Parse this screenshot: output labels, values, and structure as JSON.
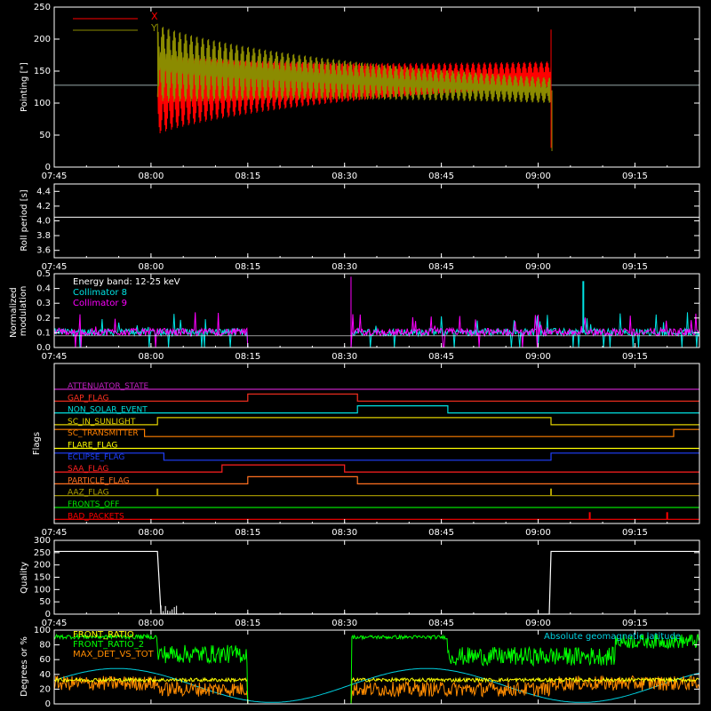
{
  "colors": {
    "axis": "#ffffff",
    "x": "#ff0000",
    "y": "#8b8b00",
    "coll8": "#00e5e5",
    "coll9": "#ff00ff",
    "front_ratio": "#ffff00",
    "front_ratio_2": "#00ff00",
    "max_det": "#ff8c00",
    "geomag": "#00d0e0"
  },
  "time_axis": {
    "start": "07:45",
    "end": "09:25",
    "ticks": [
      "07:45",
      "08:00",
      "08:15",
      "08:30",
      "08:45",
      "09:00",
      "09:15"
    ]
  },
  "chart_data": [
    {
      "type": "line",
      "id": "pointing",
      "ylabel": "Pointing [\"]",
      "ylim": [
        0,
        250
      ],
      "yticks": [
        "0",
        "50",
        "100",
        "150",
        "200",
        "250"
      ],
      "legend": "top-left",
      "series": [
        {
          "name": "X",
          "color_key": "x",
          "t_range": [
            "08:01",
            "09:02"
          ],
          "mean": [
            110,
            145
          ],
          "amp": [
            45,
            15
          ]
        },
        {
          "name": "Y",
          "color_key": "y",
          "t_range": [
            "08:01",
            "09:02"
          ],
          "mean": [
            165,
            120
          ],
          "amp": [
            45,
            15
          ]
        }
      ],
      "reference_level": 128
    },
    {
      "type": "line",
      "id": "roll",
      "ylabel": "Roll period [s]",
      "ylim": [
        3.5,
        4.5
      ],
      "yticks": [
        "3.6",
        "3.8",
        "4.0",
        "4.2",
        "4.4"
      ],
      "value": 4.05
    },
    {
      "type": "line",
      "id": "modulation",
      "ylabel": "Normalized modulation",
      "ylim": [
        0,
        0.5
      ],
      "yticks": [
        "0.0",
        "0.1",
        "0.2",
        "0.3",
        "0.4",
        "0.5"
      ],
      "annotation": "Energy band: 12-25 keV",
      "series": [
        {
          "name": "Collimator 8",
          "color_key": "coll8"
        },
        {
          "name": "Collimator 9",
          "color_key": "coll9"
        }
      ],
      "gap": [
        "08:15",
        "08:31"
      ]
    },
    {
      "type": "line",
      "id": "flags",
      "ylabel": "Flags",
      "series": [
        {
          "name": "ATTENUATOR_STATE",
          "color": "#c020c0",
          "on": []
        },
        {
          "name": "GAP_FLAG",
          "color": "#ff3020",
          "on": [
            [
              "08:15",
              "08:32"
            ]
          ]
        },
        {
          "name": "NON_SOLAR_EVENT",
          "color": "#00e0e0",
          "on": [
            [
              "08:32",
              "08:46"
            ]
          ]
        },
        {
          "name": "SC_IN_SUNLIGHT",
          "color": "#e0d000",
          "on": [
            [
              "08:01",
              "09:02"
            ]
          ]
        },
        {
          "name": "SC_TRANSMITTER",
          "color": "#ff8000",
          "off": [
            [
              "07:59",
              "09:21"
            ]
          ]
        },
        {
          "name": "FLARE_FLAG",
          "color": "#ffff00",
          "on": []
        },
        {
          "name": "ECLIPSE_FLAG",
          "color": "#2040ff",
          "off": [
            [
              "08:02",
              "09:02"
            ]
          ]
        },
        {
          "name": "SAA_FLAG",
          "color": "#ff2020",
          "on": [
            [
              "08:11",
              "08:30"
            ]
          ]
        },
        {
          "name": "PARTICLE_FLAG",
          "color": "#ff7020",
          "on": [
            [
              "08:15",
              "08:32"
            ]
          ]
        },
        {
          "name": "AAZ_FLAG",
          "color": "#b0a000",
          "spikes": [
            "08:01",
            "09:02"
          ]
        },
        {
          "name": "FRONTS_OFF",
          "color": "#00e000",
          "on": []
        },
        {
          "name": "BAD_PACKETS",
          "color": "#ff0000",
          "spikes": [
            "09:08",
            "09:20"
          ]
        }
      ]
    },
    {
      "type": "line",
      "id": "quality",
      "ylabel": "Quality",
      "ylim": [
        0,
        300
      ],
      "yticks": [
        "0",
        "50",
        "100",
        "150",
        "200",
        "250",
        "300"
      ],
      "value_outside": 255,
      "value_inside": 0,
      "low_range": [
        "08:01",
        "09:02"
      ]
    },
    {
      "type": "line",
      "id": "degrees",
      "ylabel": "Degrees or %",
      "ylim": [
        0,
        100
      ],
      "yticks": [
        "0",
        "20",
        "40",
        "60",
        "80",
        "100"
      ],
      "series": [
        {
          "name": "FRONT_RATIO",
          "color_key": "front_ratio",
          "legend": "left"
        },
        {
          "name": "FRONT_RATIO_2",
          "color_key": "front_ratio_2",
          "legend": "left"
        },
        {
          "name": "MAX_DET_VS_TOT",
          "color_key": "max_det",
          "legend": "left"
        },
        {
          "name": "Absolute geomagnetic latitude",
          "color_key": "geomag",
          "legend": "right"
        }
      ],
      "gap": [
        "08:15",
        "08:31"
      ]
    }
  ]
}
